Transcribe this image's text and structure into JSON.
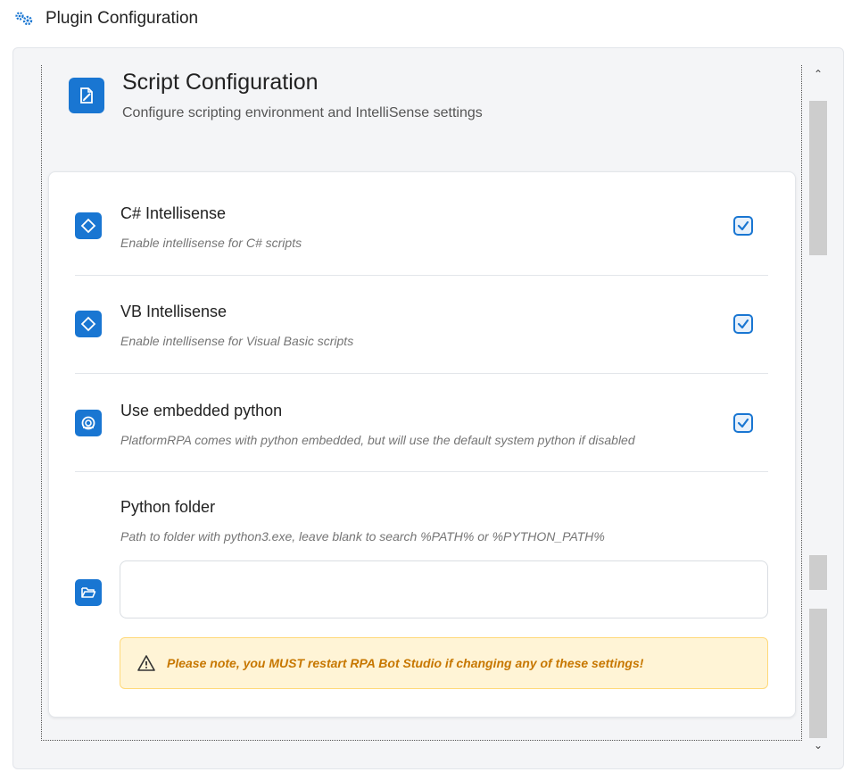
{
  "header": {
    "title": "Plugin Configuration",
    "icon": "gears-icon"
  },
  "section": {
    "title": "Script Configuration",
    "subtitle": "Configure scripting environment and IntelliSense settings",
    "icon": "edit-document-icon"
  },
  "settings": [
    {
      "title": "C# Intellisense",
      "description": "Enable intellisense for C# scripts",
      "checked": true,
      "icon": "code-diamond-icon"
    },
    {
      "title": "VB Intellisense",
      "description": "Enable intellisense for Visual Basic scripts",
      "checked": true,
      "icon": "code-diamond-icon"
    },
    {
      "title": "Use embedded python",
      "description": "PlatformRPA comes with python embedded, but will use the default system python if disabled",
      "checked": true,
      "icon": "python-icon"
    }
  ],
  "python_folder": {
    "title": "Python folder",
    "description": "Path to folder with python3.exe, leave blank to search %PATH% or %PYTHON_PATH%",
    "value": "",
    "icon": "folder-open-icon"
  },
  "warning": {
    "text": "Please note, you MUST restart RPA Bot Studio if changing any of these settings!",
    "icon": "warning-triangle-icon"
  },
  "colors": {
    "accent": "#1976d2",
    "warning_bg": "#fff4d6",
    "warning_text": "#c77700"
  }
}
